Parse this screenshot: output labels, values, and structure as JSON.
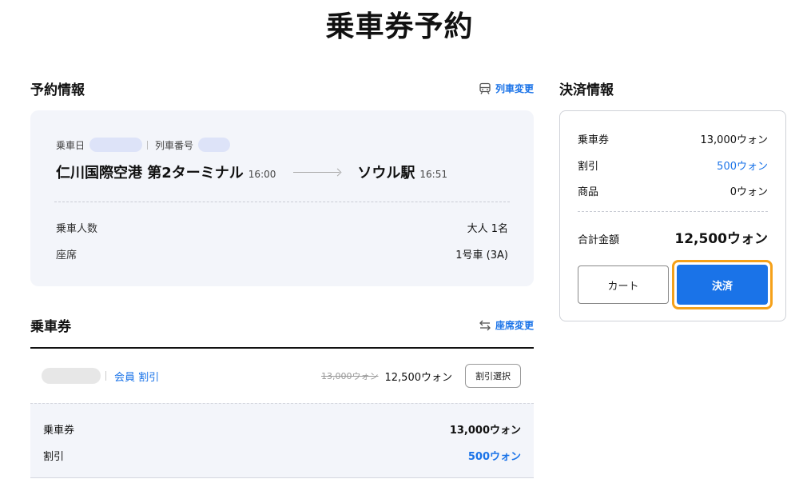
{
  "page": {
    "title": "乗車券予約"
  },
  "reservation": {
    "section_title": "予約情報",
    "change_train_label": "列車変更",
    "boarding_date_label": "乗車日",
    "train_number_label": "列車番号",
    "departure_station": "仁川国際空港 第2ターミナル",
    "departure_time": "16:00",
    "arrival_station": "ソウル駅",
    "arrival_time": "16:51",
    "rows": [
      {
        "label": "乗車人数",
        "value": "大人 1名"
      },
      {
        "label": "座席",
        "value": "1号車 (3A)"
      }
    ]
  },
  "ticket": {
    "section_title": "乗車券",
    "change_seat_label": "座席変更",
    "member_discount_label": "会員 割引",
    "original_price": "13,000ウォン",
    "discounted_price": "12,500ウォン",
    "discount_select_label": "割引選択",
    "details": [
      {
        "label": "乗車券",
        "value": "13,000ウォン"
      },
      {
        "label": "割引",
        "value": "500ウォン"
      }
    ]
  },
  "payment": {
    "section_title": "決済情報",
    "rows": [
      {
        "label": "乗車券",
        "value": "13,000ウォン"
      },
      {
        "label": "割引",
        "value": "500ウォン"
      },
      {
        "label": "商品",
        "value": "0ウォン"
      }
    ],
    "total_label": "合計金額",
    "total_value": "12,500ウォン",
    "cart_button": "カート",
    "pay_button": "決済"
  },
  "colors": {
    "accent": "#1a73e8",
    "highlight": "#f5a11a",
    "card_bg": "#f3f5fa"
  }
}
